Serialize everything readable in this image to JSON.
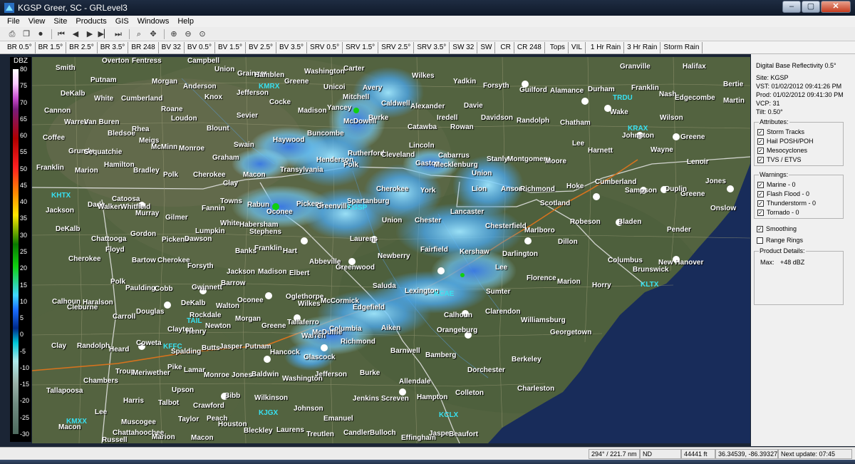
{
  "window": {
    "title": "KGSP Greer, SC - GRLevel3",
    "minimize": "–",
    "maximize": "▢",
    "close": "✕"
  },
  "menu": [
    "File",
    "View",
    "Site",
    "Products",
    "GIS",
    "Windows",
    "Help"
  ],
  "product_tabs": [
    "BR 0.5°",
    "BR 1.5°",
    "BR 2.5°",
    "BR 3.5°",
    "BR 248",
    "BV 32",
    "BV 0.5°",
    "BV 1.5°",
    "BV 2.5°",
    "BV 3.5°",
    "SRV 0.5°",
    "SRV 1.5°",
    "SRV 2.5°",
    "SRV 3.5°",
    "SW 32",
    "SW",
    "CR",
    "CR 248",
    "Tops",
    "VIL",
    "1 Hr Rain",
    "3 Hr Rain",
    "Storm Rain"
  ],
  "legend": {
    "title": "DBZ",
    "ticks": [
      "80",
      "75",
      "70",
      "65",
      "60",
      "55",
      "50",
      "45",
      "40",
      "35",
      "30",
      "25",
      "20",
      "15",
      "10",
      "5",
      "0",
      "-5",
      "-10",
      "-15",
      "-20",
      "-25",
      "-30"
    ]
  },
  "map": {
    "places": [
      [
        "Smith",
        33,
        10
      ],
      [
        "Putnam",
        82,
        27
      ],
      [
        "Overton",
        98,
        0
      ],
      [
        "Fentress",
        140,
        0
      ],
      [
        "Campbell",
        218,
        -2
      ],
      [
        "Union",
        256,
        12
      ],
      [
        "Grainger",
        288,
        18
      ],
      [
        "Hamblen",
        312,
        20
      ],
      [
        "Washington",
        382,
        15
      ],
      [
        "Carter",
        437,
        11
      ],
      [
        "Wilkes",
        533,
        21
      ],
      [
        "Granville",
        825,
        8
      ],
      [
        "Halifax",
        913,
        8
      ],
      [
        "Bertie",
        982,
        33
      ],
      [
        "DeKalb",
        40,
        46
      ],
      [
        "White",
        87,
        53
      ],
      [
        "Cumberland",
        125,
        53
      ],
      [
        "Morgan",
        168,
        29
      ],
      [
        "Anderson",
        212,
        36
      ],
      [
        "Knox",
        242,
        51
      ],
      [
        "Jefferson",
        287,
        45
      ],
      [
        "Greene",
        354,
        29
      ],
      [
        "Unicoi",
        409,
        37
      ],
      [
        "Avery",
        464,
        38
      ],
      [
        "Caldwell",
        490,
        60
      ],
      [
        "Alexander",
        531,
        64
      ],
      [
        "Yadkin",
        591,
        29
      ],
      [
        "Forsyth",
        633,
        35
      ],
      [
        "Guilford",
        684,
        41
      ],
      [
        "Alamance",
        727,
        42
      ],
      [
        "Durham",
        780,
        40
      ],
      [
        "Franklin",
        841,
        38
      ],
      [
        "Nash",
        880,
        47
      ],
      [
        "Edgecombe",
        902,
        52
      ],
      [
        "Martin",
        970,
        56
      ],
      [
        "Cannon",
        17,
        70
      ],
      [
        "Roane",
        181,
        68
      ],
      [
        "Cocke",
        333,
        58
      ],
      [
        "Madison",
        373,
        70
      ],
      [
        "Yancey",
        414,
        66
      ],
      [
        "Mitchell",
        436,
        51
      ],
      [
        "Burke",
        472,
        80
      ],
      [
        "Iredell",
        568,
        80
      ],
      [
        "Davie",
        606,
        63
      ],
      [
        "Davidson",
        630,
        80
      ],
      [
        "Randolph",
        680,
        84
      ],
      [
        "Chatham",
        741,
        87
      ],
      [
        "Wake",
        811,
        72
      ],
      [
        "Wilson",
        881,
        80
      ],
      [
        "Warren",
        45,
        86
      ],
      [
        "Van Buren",
        73,
        86
      ],
      [
        "Loudon",
        195,
        81
      ],
      [
        "Sevier",
        287,
        77
      ],
      [
        "McDowell",
        437,
        85
      ],
      [
        "Catawba",
        527,
        93
      ],
      [
        "Rowan",
        587,
        93
      ],
      [
        "Bledsoe",
        106,
        102
      ],
      [
        "Rhea",
        140,
        96
      ],
      [
        "Blount",
        245,
        95
      ],
      [
        "Haywood",
        338,
        111
      ],
      [
        "Buncombe",
        386,
        102
      ],
      [
        "Johnston",
        828,
        105
      ],
      [
        "Wayne",
        868,
        125
      ],
      [
        "Greene",
        910,
        107
      ],
      [
        "Coffee",
        15,
        108
      ],
      [
        "Meigs",
        150,
        112
      ],
      [
        "McMinn",
        167,
        121
      ],
      [
        "Monroe",
        206,
        123
      ],
      [
        "Swain",
        283,
        118
      ],
      [
        "Lincoln",
        529,
        119
      ],
      [
        "Cabarrus",
        570,
        133
      ],
      [
        "Stanly",
        638,
        138
      ],
      [
        "Montgomery",
        667,
        138
      ],
      [
        "Moore",
        720,
        141
      ],
      [
        "Harnett",
        780,
        126
      ],
      [
        "Lee",
        758,
        116
      ],
      [
        "Grundy",
        51,
        127
      ],
      [
        "Sequatchie",
        73,
        128
      ],
      [
        "Graham",
        253,
        136
      ],
      [
        "Henderson",
        399,
        139
      ],
      [
        "Rutherford",
        443,
        130
      ],
      [
        "Cleveland",
        490,
        132
      ],
      [
        "Gaston",
        538,
        144
      ],
      [
        "Mecklenburg",
        564,
        146
      ],
      [
        "Lenoir",
        919,
        142
      ],
      [
        "Franklin",
        6,
        150
      ],
      [
        "Marion",
        60,
        154
      ],
      [
        "Hamilton",
        101,
        146
      ],
      [
        "Bradley",
        142,
        154
      ],
      [
        "Polk",
        184,
        160
      ],
      [
        "Cherokee",
        226,
        160
      ],
      [
        "Macon",
        296,
        160
      ],
      [
        "Transylvania",
        348,
        153
      ],
      [
        "Polk",
        437,
        146
      ],
      [
        "Union",
        617,
        158
      ],
      [
        "Cumberland",
        790,
        170
      ],
      [
        "Duplin",
        888,
        180
      ],
      [
        "Jones",
        945,
        169
      ],
      [
        "Sampson",
        832,
        182
      ],
      [
        "Clay",
        268,
        172
      ],
      [
        "Cherokee",
        483,
        180
      ],
      [
        "York",
        545,
        182
      ],
      [
        "Lion",
        617,
        180
      ],
      [
        "Anson",
        658,
        180
      ],
      [
        "Richmond",
        685,
        180
      ],
      [
        "Hoke",
        750,
        176
      ],
      [
        "Greene",
        910,
        187
      ],
      [
        "Catoosa",
        112,
        194
      ],
      [
        "Dade",
        78,
        202
      ],
      [
        "Walker",
        92,
        205
      ],
      [
        "Whitfield",
        124,
        205
      ],
      [
        "Towns",
        264,
        197
      ],
      [
        "Rabun",
        302,
        202
      ],
      [
        "Oconee",
        329,
        212
      ],
      [
        "Pickens",
        371,
        201
      ],
      [
        "Greenville",
        399,
        204
      ],
      [
        "Spartanburg",
        442,
        197
      ],
      [
        "Union",
        491,
        224
      ],
      [
        "Chester",
        537,
        224
      ],
      [
        "Lancaster",
        587,
        212
      ],
      [
        "Scotland",
        713,
        200
      ],
      [
        "Onslow",
        952,
        207
      ],
      [
        "Jackson",
        19,
        210
      ],
      [
        "Murray",
        145,
        214
      ],
      [
        "Fannin",
        238,
        207
      ],
      [
        "Gilmer",
        187,
        220
      ],
      [
        "White",
        264,
        228
      ],
      [
        "Habersham",
        291,
        230
      ],
      [
        "Stephens",
        305,
        240
      ],
      [
        "Robeson",
        755,
        226
      ],
      [
        "Bladen",
        822,
        226
      ],
      [
        "Pender",
        891,
        237
      ],
      [
        "DeKalb",
        33,
        236
      ],
      [
        "Chattooga",
        83,
        250
      ],
      [
        "Gordon",
        138,
        243
      ],
      [
        "Lumpkin",
        229,
        239
      ],
      [
        "Pickens",
        182,
        251
      ],
      [
        "Dawson",
        214,
        250
      ],
      [
        "Laurens",
        446,
        250
      ],
      [
        "Chesterfield",
        636,
        232
      ],
      [
        "Marlboro",
        691,
        238
      ],
      [
        "Dillon",
        738,
        254
      ],
      [
        "Floyd",
        103,
        265
      ],
      [
        "Franklin",
        312,
        263
      ],
      [
        "Hart",
        352,
        267
      ],
      [
        "Fairfield",
        545,
        265
      ],
      [
        "Kershaw",
        600,
        268
      ],
      [
        "Darlington",
        660,
        271
      ],
      [
        "Cherokee",
        51,
        278
      ],
      [
        "Bartow",
        140,
        280
      ],
      [
        "Cherokee",
        176,
        280
      ],
      [
        "Forsyth",
        218,
        288
      ],
      [
        "Banks",
        285,
        267
      ],
      [
        "Abbeville",
        389,
        282
      ],
      [
        "Newberry",
        485,
        274
      ],
      [
        "Columbus",
        808,
        280
      ],
      [
        "New Hanover",
        879,
        283
      ],
      [
        "Brunswick",
        843,
        293
      ],
      [
        "Polk",
        110,
        310
      ],
      [
        "Paulding",
        131,
        319
      ],
      [
        "Cobb",
        172,
        320
      ],
      [
        "Gwinnett",
        224,
        318
      ],
      [
        "Jackson",
        273,
        296
      ],
      [
        "Madison",
        317,
        296
      ],
      [
        "Elbert",
        361,
        298
      ],
      [
        "Greenwood",
        426,
        290
      ],
      [
        "Lee",
        650,
        290
      ],
      [
        "Florence",
        694,
        305
      ],
      [
        "Marion",
        737,
        310
      ],
      [
        "Horry",
        786,
        315
      ],
      [
        "Barrow",
        265,
        312
      ],
      [
        "Oglethorpe",
        356,
        331
      ],
      [
        "Wilkes",
        373,
        341
      ],
      [
        "McCormick",
        405,
        337
      ],
      [
        "Saluda",
        478,
        316
      ],
      [
        "Lexington",
        523,
        323
      ],
      [
        "Sumter",
        637,
        324
      ],
      [
        "Edgefield",
        450,
        346
      ],
      [
        "Calhoun",
        578,
        357
      ],
      [
        "Clarendon",
        636,
        352
      ],
      [
        "Calhoun",
        28,
        338
      ],
      [
        "Haralson",
        71,
        339
      ],
      [
        "Cleburne",
        49,
        346
      ],
      [
        "Carroll",
        113,
        359
      ],
      [
        "Douglas",
        146,
        352
      ],
      [
        "DeKalb",
        209,
        340
      ],
      [
        "Walton",
        258,
        344
      ],
      [
        "Oconee",
        288,
        336
      ],
      [
        "Rockdale",
        221,
        357
      ],
      [
        "Newton",
        243,
        372
      ],
      [
        "Morgan",
        285,
        362
      ],
      [
        "Greene",
        322,
        372
      ],
      [
        "Taliaferro",
        358,
        367
      ],
      [
        "Columbia",
        417,
        376
      ],
      [
        "Williamsburg",
        686,
        364
      ],
      [
        "Clayton",
        190,
        377
      ],
      [
        "Henry",
        216,
        380
      ],
      [
        "Warren",
        378,
        386
      ],
      [
        "McDuffie",
        393,
        381
      ],
      [
        "Richmond",
        433,
        394
      ],
      [
        "Aiken",
        490,
        375
      ],
      [
        "Orangeburg",
        568,
        378
      ],
      [
        "Georgetown",
        727,
        381
      ],
      [
        "Clay",
        27,
        400
      ],
      [
        "Randolph",
        63,
        400
      ],
      [
        "Heard",
        108,
        405
      ],
      [
        "Coweta",
        146,
        396
      ],
      [
        "Spalding",
        195,
        408
      ],
      [
        "Butts",
        238,
        403
      ],
      [
        "Jasper",
        263,
        401
      ],
      [
        "Putnam",
        299,
        401
      ],
      [
        "Hancock",
        334,
        409
      ],
      [
        "Glascock",
        381,
        416
      ],
      [
        "Barnwell",
        503,
        407
      ],
      [
        "Bamberg",
        552,
        413
      ],
      [
        "Berkeley",
        673,
        419
      ],
      [
        "Troup",
        117,
        436
      ],
      [
        "Meriwether",
        141,
        438
      ],
      [
        "Pike",
        190,
        430
      ],
      [
        "Lamar",
        213,
        434
      ],
      [
        "Monroe",
        241,
        441
      ],
      [
        "Jones",
        280,
        441
      ],
      [
        "Baldwin",
        308,
        440
      ],
      [
        "Washington",
        351,
        446
      ],
      [
        "Jefferson",
        397,
        440
      ],
      [
        "Burke",
        460,
        438
      ],
      [
        "Dorchester",
        611,
        434
      ],
      [
        "Chambers",
        72,
        449
      ],
      [
        "Upson",
        196,
        462
      ],
      [
        "Allendale",
        515,
        450
      ],
      [
        "Tallapoosa",
        20,
        463
      ],
      [
        "Harris",
        128,
        477
      ],
      [
        "Talbot",
        177,
        480
      ],
      [
        "Crawford",
        226,
        484
      ],
      [
        "Bibb",
        270,
        470
      ],
      [
        "Wilkinson",
        312,
        473
      ],
      [
        "Johnson",
        367,
        488
      ],
      [
        "Jenkins",
        450,
        474
      ],
      [
        "Screven",
        490,
        474
      ],
      [
        "Hampton",
        540,
        472
      ],
      [
        "Colleton",
        594,
        466
      ],
      [
        "Charleston",
        681,
        460
      ],
      [
        "Lee",
        88,
        493
      ],
      [
        "Muscogee",
        125,
        507
      ],
      [
        "Taylor",
        205,
        503
      ],
      [
        "Peach",
        245,
        502
      ],
      [
        "Houston",
        261,
        510
      ],
      [
        "Laurens",
        343,
        518
      ],
      [
        "Emanuel",
        409,
        502
      ],
      [
        "Bulloch",
        474,
        522
      ],
      [
        "Candler",
        437,
        522
      ],
      [
        "Effingham",
        518,
        529
      ],
      [
        "Macon",
        37,
        514
      ],
      [
        "Chattahoochee",
        113,
        522
      ],
      [
        "Marion",
        168,
        528
      ],
      [
        "Macon",
        223,
        529
      ],
      [
        "Bleckley",
        297,
        519
      ],
      [
        "Treutlen",
        385,
        524
      ],
      [
        "Jasper",
        557,
        523
      ],
      [
        "Beaufort",
        585,
        524
      ],
      [
        "Russell",
        98,
        532
      ]
    ],
    "sites": [
      [
        "KHTX",
        27,
        189
      ],
      [
        "KMRX",
        318,
        36
      ],
      [
        "TRDU",
        815,
        52
      ],
      [
        "KRAX",
        836,
        95
      ],
      [
        "KLTX",
        854,
        314
      ],
      [
        "TAIL",
        217,
        365
      ],
      [
        "KFFC",
        184,
        401
      ],
      [
        "KCAE",
        564,
        327
      ],
      [
        "KJGX",
        318,
        494
      ],
      [
        "KCLX",
        571,
        497
      ],
      [
        "KMXX",
        48,
        506
      ],
      [
        "KGSP",
        442,
        206
      ]
    ]
  },
  "sidebar": {
    "product": "Digital Base Reflectivity 0.5°",
    "site": "Site:  KGSP",
    "vst": "VST:  01/02/2012  09:41:26 PM",
    "prod": "Prod: 01/02/2012  09:41:30 PM",
    "vcp": "VCP:  31",
    "tilt": "Tilt:  0.50°",
    "attributes_label": "Attributes:",
    "attributes": [
      "Storm Tracks",
      "Hail POSH/POH",
      "Mesocyclones",
      "TVS / ETVS"
    ],
    "warnings_label": "Warnings:",
    "warnings": [
      "Marine - 0",
      "Flash Flood - 0",
      "Thunderstorm - 0",
      "Tornado - 0"
    ],
    "smoothing": "Smoothing",
    "range_rings": "Range Rings",
    "details_label": "Product Details:",
    "max_label": "Max:",
    "max_value": "+48 dBZ"
  },
  "status": {
    "bearing": "294° / 221.7 nm",
    "value": "ND",
    "height": "44441 ft",
    "coords": "36.34539, -86.39327",
    "next_update": "Next update: 07:45"
  }
}
